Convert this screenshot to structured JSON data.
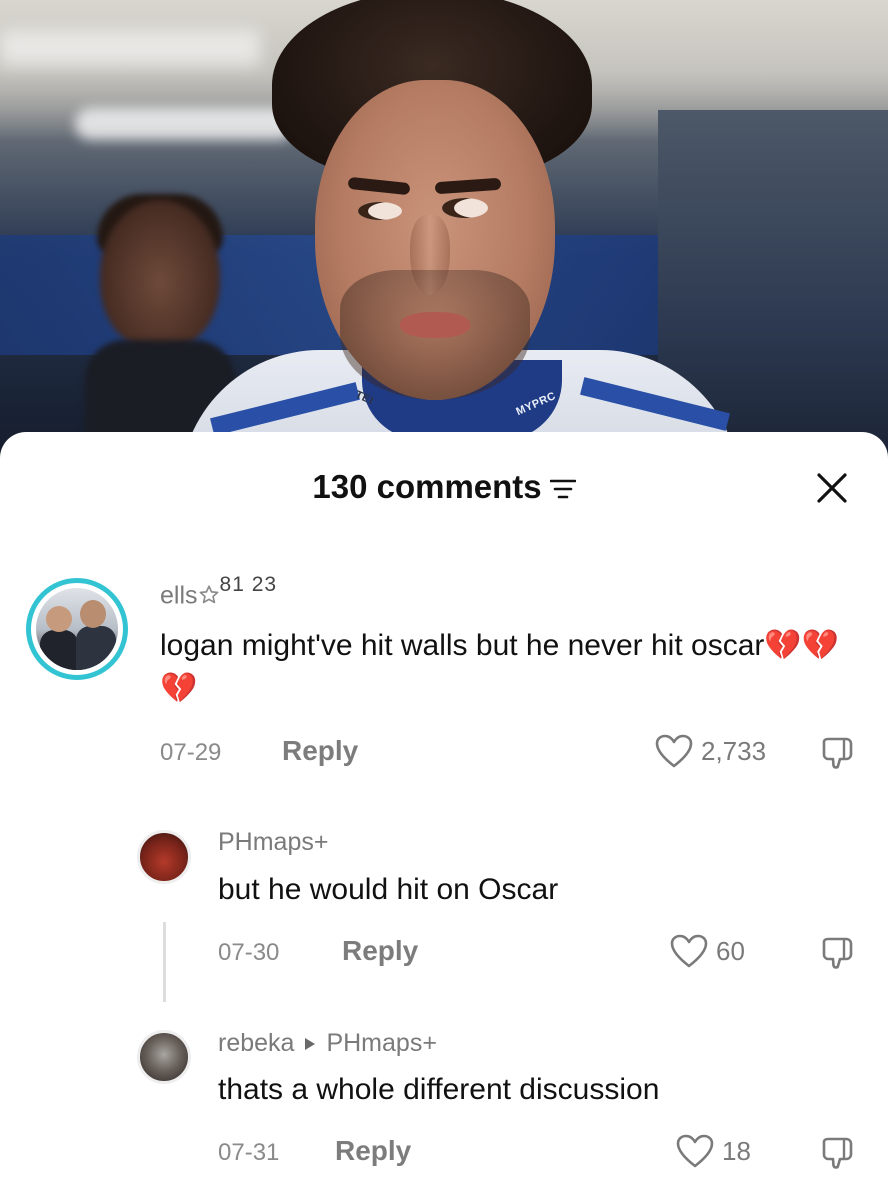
{
  "header": {
    "comment_count": "130 comments"
  },
  "comments": [
    {
      "username": "ells",
      "badge": "81 23",
      "text": "logan might've hit walls but he never hit oscar💔💔💔",
      "date": "07-29",
      "reply_label": "Reply",
      "likes": "2,733"
    },
    {
      "username": "PHmaps+",
      "text": "but he would hit on Oscar",
      "date": "07-30",
      "reply_label": "Reply",
      "likes": "60"
    },
    {
      "username": "rebeka",
      "reply_to": "PHmaps+",
      "text": "thats a whole different discussion",
      "date": "07-31",
      "reply_label": "Reply",
      "likes": "18"
    }
  ],
  "photo": {
    "collar_text_left": "TEI",
    "collar_text_right": "MYPRC"
  },
  "colors": {
    "avatar_ring": "#33c4d4",
    "text_primary": "#111111",
    "text_secondary": "#7a7a7a"
  }
}
